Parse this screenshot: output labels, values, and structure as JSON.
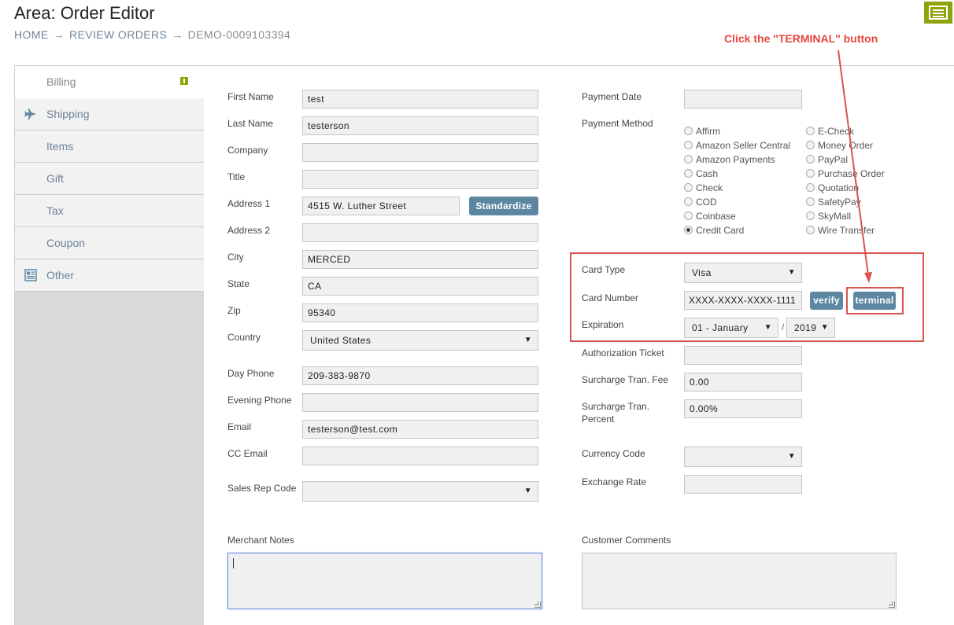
{
  "header": {
    "title": "Area: Order Editor",
    "breadcrumb": [
      "HOME",
      "REVIEW ORDERS",
      "DEMO-0009103394"
    ],
    "breadcrumb_separator": "→"
  },
  "sidebar": {
    "items": [
      {
        "label": "Billing",
        "icon": "info-badge-icon",
        "active": true
      },
      {
        "label": "Shipping",
        "icon": "airplane-icon"
      },
      {
        "label": "Items"
      },
      {
        "label": "Gift"
      },
      {
        "label": "Tax"
      },
      {
        "label": "Coupon"
      },
      {
        "label": "Other",
        "icon": "newspaper-icon"
      }
    ]
  },
  "billing": {
    "first_name": {
      "label": "First Name",
      "value": "test"
    },
    "last_name": {
      "label": "Last Name",
      "value": "testerson"
    },
    "company": {
      "label": "Company",
      "value": ""
    },
    "title": {
      "label": "Title",
      "value": ""
    },
    "address1": {
      "label": "Address 1",
      "value": "4515 W. Luther Street"
    },
    "standardize_label": "Standardize",
    "address2": {
      "label": "Address 2",
      "value": ""
    },
    "city": {
      "label": "City",
      "value": "MERCED"
    },
    "state": {
      "label": "State",
      "value": "CA"
    },
    "zip": {
      "label": "Zip",
      "value": "95340"
    },
    "country": {
      "label": "Country",
      "value": "United States"
    },
    "day_phone": {
      "label": "Day Phone",
      "value": "209-383-9870"
    },
    "evening_phone": {
      "label": "Evening Phone",
      "value": ""
    },
    "email": {
      "label": "Email",
      "value": "testerson@test.com"
    },
    "cc_email": {
      "label": "CC Email",
      "value": ""
    },
    "sales_rep_code": {
      "label": "Sales Rep Code",
      "value": ""
    },
    "merchant_notes": {
      "label": "Merchant Notes",
      "value": ""
    }
  },
  "payment": {
    "payment_date": {
      "label": "Payment Date",
      "value": ""
    },
    "payment_method_label": "Payment Method",
    "methods_col1": [
      "Affirm",
      "Amazon Seller Central",
      "Amazon Payments",
      "Cash",
      "Check",
      "COD",
      "Coinbase",
      "Credit Card"
    ],
    "methods_col2": [
      "E-Check",
      "Money Order",
      "PayPal",
      "Purchase Order",
      "Quotation",
      "SafetyPay",
      "SkyMall",
      "Wire Transfer"
    ],
    "selected_method": "Credit Card",
    "card_type": {
      "label": "Card Type",
      "value": "Visa"
    },
    "card_number": {
      "label": "Card Number",
      "value": "XXXX-XXXX-XXXX-1111"
    },
    "verify_label": "verify",
    "terminal_label": "terminal",
    "expiration": {
      "label": "Expiration",
      "month": "01 - January",
      "separator": "/",
      "year": "2019"
    },
    "authorization_ticket": {
      "label": "Authorization Ticket",
      "value": ""
    },
    "surcharge_fee": {
      "label": "Surcharge Tran. Fee",
      "value": "0.00"
    },
    "surcharge_percent": {
      "label_line1": "Surcharge Tran.",
      "label_line2": "Percent",
      "value": "0.00%"
    },
    "currency_code": {
      "label": "Currency Code",
      "value": ""
    },
    "exchange_rate": {
      "label": "Exchange Rate",
      "value": ""
    },
    "customer_comments": {
      "label": "Customer Comments",
      "value": ""
    }
  },
  "annotation": {
    "text": "Click the \"TERMINAL\" button",
    "color": "#e8453c"
  },
  "colors": {
    "accent_button": "#5d87a1",
    "brand_green": "#8fa30b",
    "link": "#6e8499"
  }
}
